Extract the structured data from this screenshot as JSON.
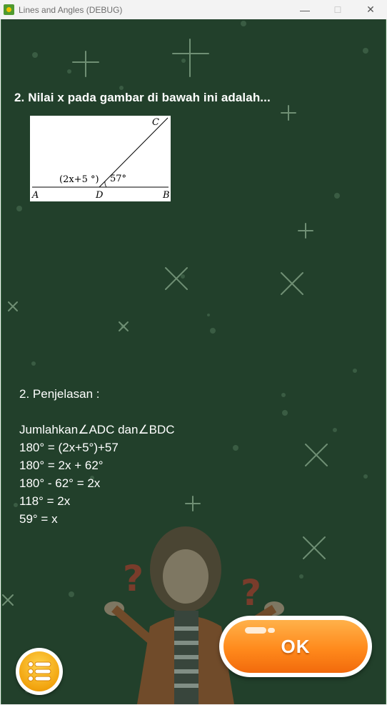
{
  "window": {
    "title": "Lines and Angles (DEBUG)",
    "minimize_glyph": "—",
    "maximize_glyph": "☐",
    "close_glyph": "✕"
  },
  "question": {
    "text": "2. Nilai x pada gambar di bawah ini adalah..."
  },
  "figure": {
    "angle_left_label": "(2x+5 °)",
    "angle_right_label": "57°",
    "point_a": "A",
    "point_b": "B",
    "point_c": "C",
    "point_d": "D"
  },
  "explanation": {
    "heading": "2. Penjelasan :",
    "lines": [
      "Jumlahkan∠ADC dan∠BDC",
      "180° = (2x+5°)+57",
      "180° = 2x + 62°",
      "180° - 62° = 2x",
      "118° = 2x",
      "59° = x"
    ]
  },
  "buttons": {
    "ok_label": "OK",
    "menu_icon": "list-menu-icon"
  },
  "colors": {
    "board": "#22402b",
    "ok_orange": "#ff8a1c",
    "menu_gold": "#f2a40f"
  }
}
